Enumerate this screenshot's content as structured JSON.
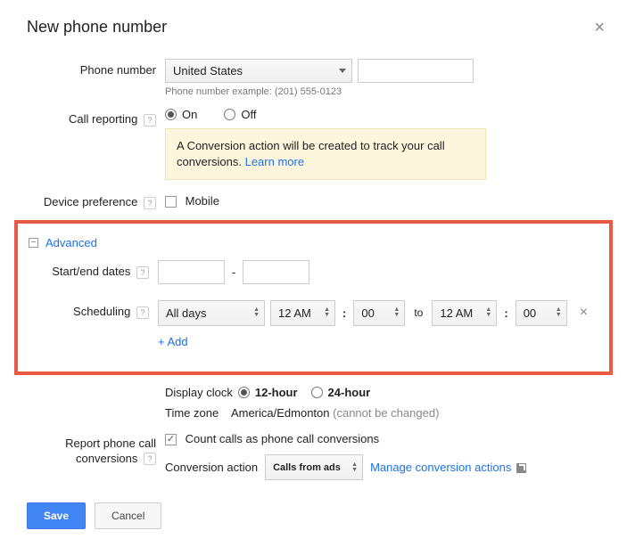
{
  "title": "New phone number",
  "labels": {
    "phone_number": "Phone number",
    "call_reporting": "Call reporting",
    "device_preference": "Device preference",
    "start_end_dates": "Start/end dates",
    "scheduling": "Scheduling",
    "report_phone": "Report phone call",
    "conversions": "conversions"
  },
  "phone": {
    "country_selected": "United States",
    "example": "Phone number example: (201) 555-0123"
  },
  "call_reporting": {
    "on": "On",
    "off": "Off",
    "selected": "on",
    "info_text": "A Conversion action will be created to track your call conversions. ",
    "learn_more": "Learn more"
  },
  "device": {
    "mobile": "Mobile"
  },
  "advanced": {
    "title": "Advanced",
    "date_sep": "-"
  },
  "scheduling": {
    "days": "All days",
    "hour1": "12 AM",
    "min1": "00",
    "to": "to",
    "hour2": "12 AM",
    "min2": "00",
    "add": "+ Add"
  },
  "clock": {
    "label": "Display clock",
    "h12": "12-hour",
    "h24": "24-hour",
    "tz_label": "Time zone",
    "tz_value": "America/Edmonton",
    "tz_note": "(cannot be changed)"
  },
  "conversion": {
    "count_label": "Count calls as phone call conversions",
    "action_label": "Conversion action",
    "action_selected": "Calls from ads",
    "manage": "Manage conversion actions"
  },
  "buttons": {
    "save": "Save",
    "cancel": "Cancel"
  }
}
